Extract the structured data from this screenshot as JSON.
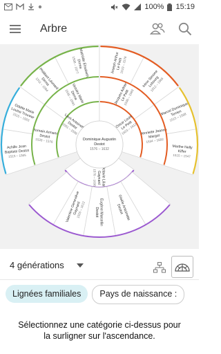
{
  "status": {
    "battery": "100%",
    "time": "15:19",
    "notification_icons": [
      "gmail-icon",
      "email-icon",
      "download-icon",
      "notification-dot-icon"
    ]
  },
  "appbar": {
    "title": "Arbre"
  },
  "fan": {
    "center": {
      "name": "Dominique Augustin Destot",
      "years": "1576 – 1632"
    },
    "gen1": [
      {
        "name": "Laus Antoinette Destot",
        "years": "1551 – 1596",
        "color": "#77b34a"
      },
      {
        "name": "Oscar Louis Le Petit",
        "years": "1553 – 1612",
        "color": "#e35c22"
      },
      {
        "name": "Octavie Liliane Gaynard",
        "years": "1576 – 1636",
        "color": "#9b59d0"
      }
    ],
    "gen2": [
      {
        "name": "Romain Armand Destot",
        "years": "1533 – 1576"
      },
      {
        "name": "Victoire Marie Dirma",
        "years": "1535 – 1590"
      },
      {
        "name": "Jacques Adrien Le Petit",
        "years": "1536 – 1583"
      },
      {
        "name": "Henriette Jeanne Margot",
        "years": "1534 – 1592"
      },
      {
        "name": "Valentine Geneviève Gaynard",
        "years": "1555 – 1612"
      },
      {
        "name": "Eugène Marcellin Destot",
        "years": ""
      },
      {
        "name": "Gisèle Antoinette Destot",
        "years": ""
      }
    ],
    "gen3": [
      {
        "name": "Achille Jean Baptiste Destot",
        "years": "1515 – 1565",
        "color": "#36aedb"
      },
      {
        "name": "Odette Marie Louise Trouvier",
        "years": "1515 – 1563",
        "color": "#36aedb"
      },
      {
        "name": "Philibert Léonard Dirma",
        "years": "1511 – 1584",
        "color": "#77b34a"
      },
      {
        "name": "Mathilde Élisabeth Dirma",
        "years": "1508 – 1577",
        "color": "#77b34a"
      },
      {
        "name": "Joseph Arthur Le Petit",
        "years": "1519 – 1578",
        "color": "#e35c22"
      },
      {
        "name": "Irène Simone Lebourg",
        "years": "1512 – 1566",
        "color": "#e35c22"
      },
      {
        "name": "Marcel Dominique Terrien",
        "years": "1515 – 1568",
        "color": "#e6c12f"
      },
      {
        "name": "Marthe Nelly Kiffer",
        "years": "1515 – 1547",
        "color": "#e6c12f"
      }
    ]
  },
  "controls": {
    "generations_label": "4 générations",
    "tree_view_icon": "tree-icon",
    "fan_view_icon": "fan-chart-icon"
  },
  "chips": [
    {
      "label": "Lignées familiales",
      "active": true
    },
    {
      "label": "Pays de naissance :",
      "active": false
    }
  ],
  "message": "Sélectionnez une catégorie ci-dessus pour la surligner sur l'ascendance.",
  "colors": {
    "accent": "#23a8c5",
    "paternal_paternal": "#36aedb",
    "paternal_maternal": "#77b34a",
    "maternal_paternal": "#e35c22",
    "maternal_maternal": "#e6c12f",
    "descendant": "#9b59d0"
  }
}
